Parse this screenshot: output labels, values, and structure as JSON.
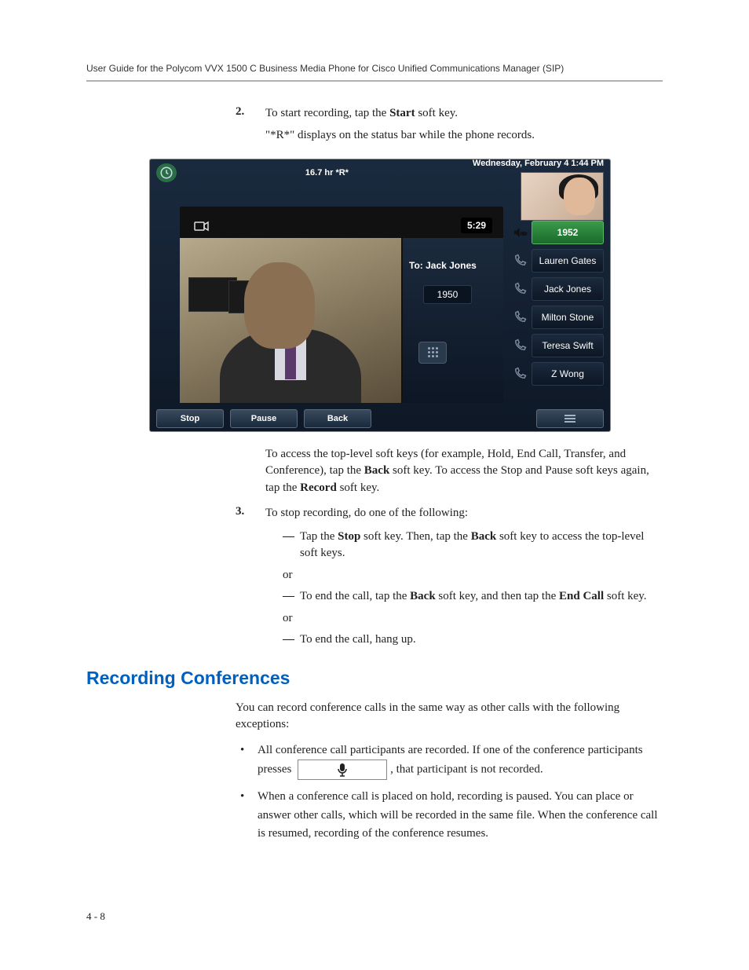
{
  "running_head": "User Guide for the Polycom VVX 1500 C Business Media Phone for Cisco Unified Communications Manager (SIP)",
  "step2": {
    "num": "2.",
    "line1a": "To start recording, tap the ",
    "line1b": "Start",
    "line1c": " soft key.",
    "line2": "\"*R*\" displays on the status bar while the phone records."
  },
  "phone": {
    "status_left": "16.7 hr  *R*",
    "status_date": "Wednesday, February 4  1:44 PM",
    "status_num": "1952",
    "timer": "5:29",
    "to_label": "To: Jack Jones",
    "to_ext": "1950",
    "active_ext": "1952",
    "contacts": [
      "Lauren Gates",
      "Jack Jones",
      "Milton Stone",
      "Teresa Swift",
      "Z Wong"
    ],
    "softkeys": [
      "Stop",
      "Pause",
      "Back"
    ]
  },
  "after_fig": {
    "p1a": "To access the top-level soft keys (for example, Hold, End Call, Transfer, and Conference), tap the ",
    "p1b": "Back",
    "p1c": " soft key. To access the Stop and Pause soft keys again, tap the ",
    "p1d": "Record",
    "p1e": " soft key."
  },
  "step3": {
    "num": "3.",
    "intro": "To stop recording, do one of the following:",
    "a1": "Tap the ",
    "a2": "Stop",
    "a3": " soft key. Then, tap the ",
    "a4": "Back",
    "a5": " soft key to access the top-level soft keys.",
    "or": "or",
    "b1": "To end the call, tap the ",
    "b2": "Back",
    "b3": " soft key, and then tap the ",
    "b4": "End Call",
    "b5": " soft key.",
    "c": "To end the call, hang up."
  },
  "section_title": "Recording Conferences",
  "conf": {
    "intro": "You can record conference calls in the same way as other calls with the following exceptions:",
    "b1a": "All conference call participants are recorded. If one of the conference participants presses ",
    "b1b": ", that participant is not recorded.",
    "b2": "When a conference call is placed on hold, recording is paused. You can place or answer other calls, which will be recorded in the same file. When the conference call is resumed, recording of the conference resumes."
  },
  "page_num": "4 - 8"
}
